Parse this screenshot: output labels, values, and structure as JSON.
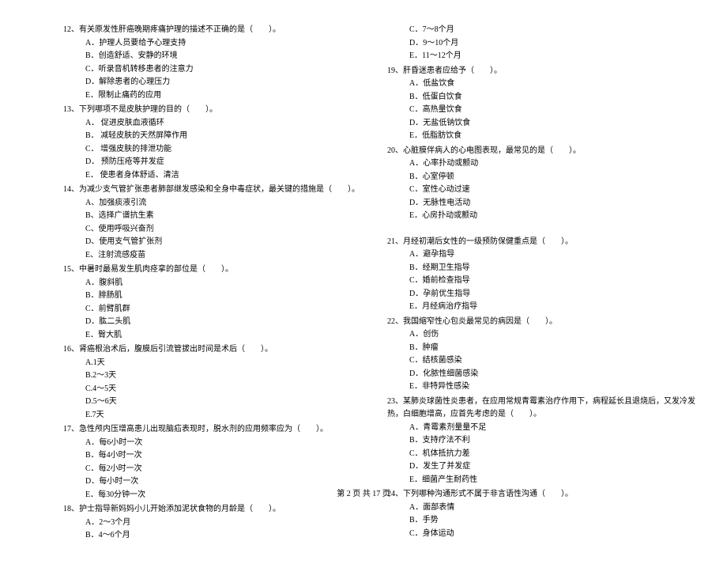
{
  "columns": [
    {
      "questions": [
        {
          "num": "12、",
          "text": "有关原发性肝癌晚期疼痛护理的描述不正确的是（　　）。",
          "options": [
            "A．护理人员要给予心理支持",
            "B．创造舒适、安静的环境",
            "C．听录音机转移患者的注意力",
            "D．解除患者的心理压力",
            "E．限制止痛药的应用"
          ]
        },
        {
          "num": "13、",
          "text": "下列哪项不是皮肤护理的目的（　　）。",
          "options": [
            "A． 促进皮肤血液循环",
            "B． 减轻皮肤的天然屏障作用",
            "C． 增强皮肤的排泄功能",
            "D． 预防压疮等并发症",
            "E． 使患者身体舒适、清洁"
          ]
        },
        {
          "num": "14、",
          "text": "为减少支气管扩张患者肺部继发感染和全身中毒症状，最关键的措施是（　　）。",
          "options": [
            "A、加强痰液引流",
            "B、选择广谱抗生素",
            "C、使用呼吸兴奋剂",
            "D、使用支气管扩张剂",
            "E、注射流感疫苗"
          ]
        },
        {
          "num": "15、",
          "text": "中暑时最易发生肌肉痉挛的部位是（　　）。",
          "options": [
            "A．腹斜肌",
            "B．腓肠肌",
            "C．前臂肌群",
            "D．肱二头肌",
            "E．臀大肌"
          ]
        },
        {
          "num": "16、",
          "text": "肾癌根治术后，腹膜后引流管拔出时间是术后（　　）。",
          "options": [
            "A.1天",
            "B.2～3天",
            "C.4～5天",
            "D.5～6天",
            "E.7天"
          ]
        },
        {
          "num": "17、",
          "text": "急性颅内压增高患儿出现脑疝表现时，脱水剂的应用频率应为（　　）。",
          "options": [
            "A．每6小时一次",
            "B．每4小时一次",
            "C．每2小时一次",
            "D．每小时一次",
            "E．每30分钟一次"
          ]
        },
        {
          "num": "18、",
          "text": "护士指导新妈妈小儿开始添加泥状食物的月龄是（　　）。",
          "options": [
            "A．2～3个月",
            "B．4～6个月"
          ]
        }
      ]
    },
    {
      "questions": [
        {
          "num": "",
          "text": "",
          "options": [
            "C．7～8个月",
            "D．9～10个月",
            "E．11～12个月"
          ]
        },
        {
          "num": "19、",
          "text": "肝昏迷患者应给予（　　）。",
          "options": [
            "A．低盐饮食",
            "B．低蛋白饮食",
            "C．高热量饮食",
            "D．无盐低钠饮食",
            "E．低脂肪饮食"
          ]
        },
        {
          "num": "20、",
          "text": "心脏膜伴病人的心电图表现，最常见的是（　　）。",
          "options": [
            "A．心率扑动或颤动",
            "B．心室停顿",
            "C．室性心动过速",
            "D．无脉性电活动",
            "E．心房扑动或颤动"
          ]
        },
        {
          "spacer": true
        },
        {
          "num": "21、",
          "text": "月经初潮后女性的一级预防保健重点是（　　）。",
          "options": [
            "A．避孕指导",
            "B．经期卫生指导",
            "C．婚前检查指导",
            "D．孕前优生指导",
            "E．月经病治疗指导"
          ]
        },
        {
          "num": "22、",
          "text": "我国缩窄性心包炎最常见的病因是（　　）。",
          "options": [
            "A．创伤",
            "B．肿瘤",
            "C．结核菌感染",
            "D．化脓性细菌感染",
            "E．非特异性感染"
          ]
        },
        {
          "num": "23、",
          "text": "某肺炎球菌性炎患者，在应用常规青霉素治疗作用下，病程延长且退烧后，又发冷发热，白细胞增高，应首先考虑的是（　　）。",
          "options": [
            "A．青霉素剂量量不足",
            "B．支持疗法不利",
            "C．机体抵抗力差",
            "D．发生了并发症",
            "E．细菌产生耐药性"
          ]
        },
        {
          "num": "24、",
          "text": "下列哪种沟通形式不属于非言语性沟通（　　）。",
          "options": [
            "A．面部表情",
            "B．手势",
            "C．身体运动"
          ]
        }
      ]
    }
  ],
  "footer": "第 2 页 共 17 页"
}
